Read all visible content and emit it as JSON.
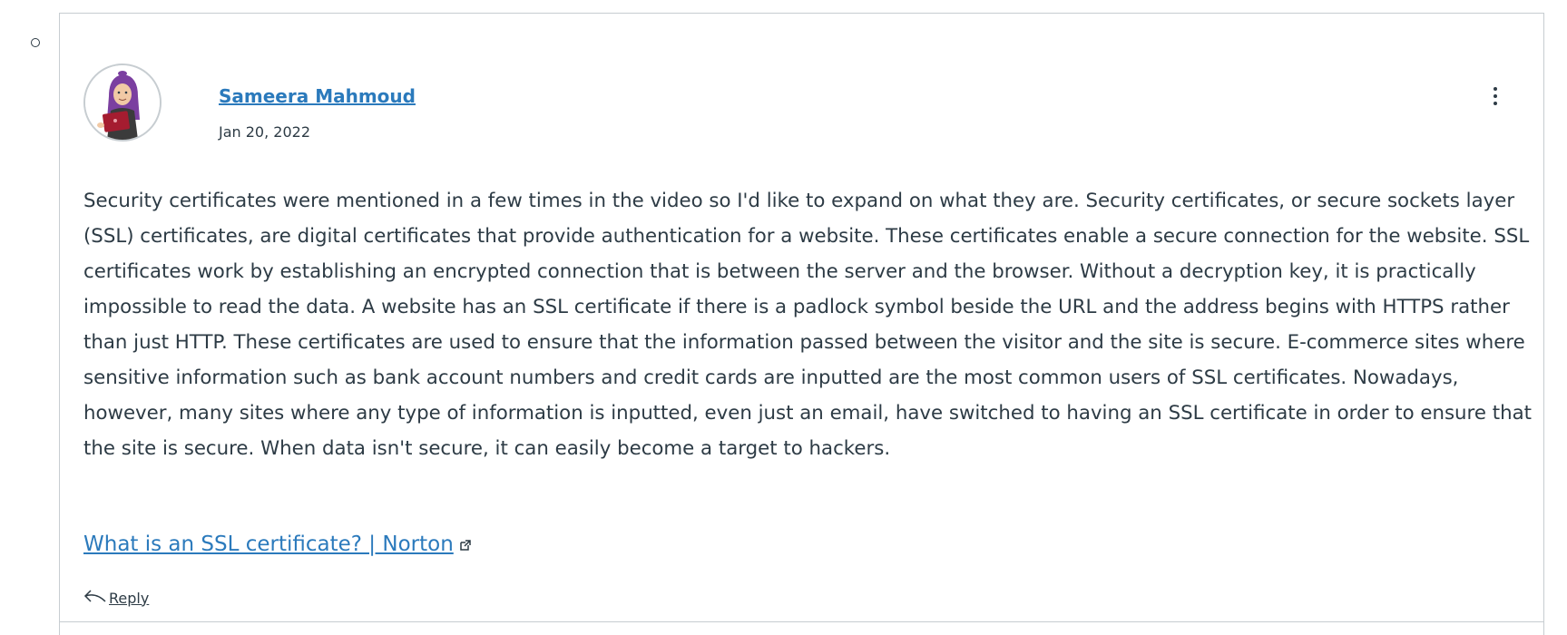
{
  "entry": {
    "author": "Sameera Mahmoud",
    "date": "Jan 20, 2022",
    "message": "Security certificates were mentioned in a few times in the video so I'd like to expand on what they are. Security certificates, or secure sockets layer (SSL) certificates, are digital certificates that provide authentication for a website. These certificates enable a secure connection for the website. SSL certificates work by establishing an encrypted connection that is between the server and the browser. Without a decryption key, it is practically impossible to read the data. A website has an SSL certificate if there is a padlock symbol beside the URL and the address begins with HTTPS rather than just HTTP. These certificates are used to ensure that the information passed between the visitor and the site is secure. E-commerce sites where sensitive information such as bank account numbers and credit cards are inputted are the most common users of SSL certificates. Nowadays, however, many sites where any type of information is inputted, even just an email, have switched to having an SSL certificate in order to ensure that the site is secure. When data isn't secure, it can easily become a target to hackers.",
    "link_text": "What is an SSL certificate? | Norton",
    "reply_label": "Reply"
  },
  "icons": {
    "bullet": "circle-bullet-icon",
    "more": "kebab-menu-icon",
    "external": "external-link-icon",
    "reply": "reply-arrow-icon"
  },
  "colors": {
    "link": "#2b7abc",
    "text": "#2d3b45",
    "border": "#c7cdd1"
  }
}
